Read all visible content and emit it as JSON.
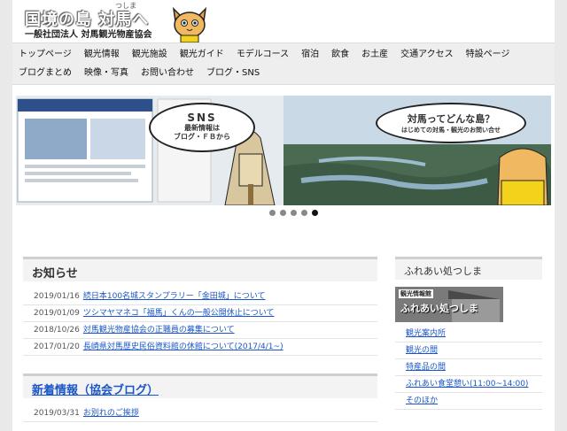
{
  "header": {
    "title": "国境の島 対馬へ",
    "furigana": "つしま",
    "subtitle": "一般社団法人 対馬観光物産協会"
  },
  "nav": {
    "row1": [
      "トップページ",
      "観光情報",
      "観光施設",
      "観光ガイド",
      "モデルコース",
      "宿泊",
      "飲食",
      "お土産",
      "交通アクセス",
      "特設ページ"
    ],
    "row2": [
      "ブログまとめ",
      "映像・写真",
      "お問い合わせ",
      "ブログ・SNS"
    ]
  },
  "slider": {
    "left": {
      "bubble_title": "SNS",
      "bubble_line1": "最新情報は",
      "bubble_line2": "ブログ・ＦＢから"
    },
    "right": {
      "bubble_title": "対馬ってどんな島？",
      "bubble_sub": "はじめての対馬・観光のお問い合せ"
    },
    "dots": 5,
    "active_dot": 5
  },
  "news": {
    "heading": "お知らせ",
    "items": [
      {
        "date": "2019/01/16",
        "text": "続日本100名城スタンプラリー「金田城」について"
      },
      {
        "date": "2019/01/09",
        "text": "ツシマヤマネコ「福馬」くんの一般公開休止について"
      },
      {
        "date": "2018/10/26",
        "text": "対馬観光物産協会の正職員の募集について"
      },
      {
        "date": "2017/01/20",
        "text": "長崎県対馬歴史民俗資料館の休館について(2017/4/1~)"
      }
    ]
  },
  "blog": {
    "heading": "新着情報（協会ブログ）",
    "items": [
      {
        "date": "2019/03/31",
        "text": "お別れのご挨拶"
      }
    ]
  },
  "sidebar": {
    "heading": "ふれあい処つしま",
    "banner_small": "観光情報館",
    "banner_big": "ふれあい処つしま",
    "links": [
      "観光案内所",
      "観光の間",
      "特産品の間",
      "ふれあい食堂憩い(11:00~14:00)",
      "そのほか"
    ]
  },
  "colors": {
    "link": "#1a56c7",
    "nav_bg": "#eeeeee",
    "page_bg": "#e9e9e9"
  }
}
